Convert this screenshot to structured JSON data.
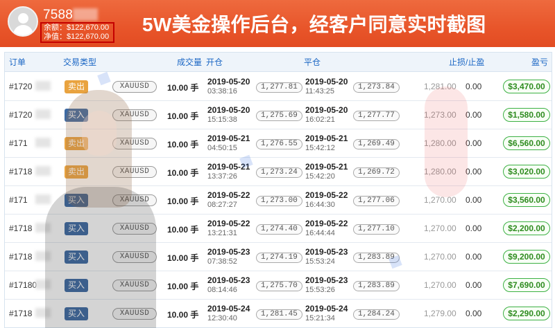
{
  "header": {
    "account_id": "7588",
    "balance": "余额：$122,670.00",
    "equity": "净值：$122,670.00",
    "headline": "5W美金操作后台，经客户同意实时截图",
    "colors": {
      "banner": "#e8552a",
      "highlight_box": "#c40000"
    }
  },
  "table": {
    "columns": {
      "order": "订单",
      "type": "交易类型",
      "volume": "成交量",
      "open": "开仓",
      "close": "平仓",
      "sl_tp": "止损/止盈",
      "profit": "盈亏"
    },
    "rows": [
      {
        "order": "#1720",
        "side": "卖出",
        "side_kind": "sell",
        "symbol": "XAUUSD",
        "volume": "10.00 手",
        "open_date": "2019-05-20",
        "open_time": "03:38:16",
        "open_price": "1,277.81",
        "close_date": "2019-05-20",
        "close_time": "11:43:25",
        "close_price": "1,273.84",
        "sl": "1,281.00",
        "tp": "0.00",
        "profit": "$3,470.00"
      },
      {
        "order": "#1720",
        "side": "买入",
        "side_kind": "buy",
        "symbol": "XAUUSD",
        "volume": "10.00 手",
        "open_date": "2019-05-20",
        "open_time": "15:15:38",
        "open_price": "1,275.69",
        "close_date": "2019-05-20",
        "close_time": "16:02:21",
        "close_price": "1,277.77",
        "sl": "1,273.00",
        "tp": "0.00",
        "profit": "$1,580.00"
      },
      {
        "order": "#171",
        "side": "卖出",
        "side_kind": "sell",
        "symbol": "XAUUSD",
        "volume": "10.00 手",
        "open_date": "2019-05-21",
        "open_time": "04:50:15",
        "open_price": "1,276.55",
        "close_date": "2019-05-21",
        "close_time": "15:42:12",
        "close_price": "1,269.49",
        "sl": "1,280.00",
        "tp": "0.00",
        "profit": "$6,560.00"
      },
      {
        "order": "#1718",
        "side": "卖出",
        "side_kind": "sell",
        "symbol": "XAUUSD",
        "volume": "10.00 手",
        "open_date": "2019-05-21",
        "open_time": "13:37:26",
        "open_price": "1,273.24",
        "close_date": "2019-05-21",
        "close_time": "15:42:20",
        "close_price": "1,269.72",
        "sl": "1,280.00",
        "tp": "0.00",
        "profit": "$3,020.00"
      },
      {
        "order": "#171",
        "side": "买入",
        "side_kind": "buy",
        "symbol": "XAUUSD",
        "volume": "10.00 手",
        "open_date": "2019-05-22",
        "open_time": "08:27:27",
        "open_price": "1,273.00",
        "close_date": "2019-05-22",
        "close_time": "16:44:30",
        "close_price": "1,277.06",
        "sl": "1,270.00",
        "tp": "0.00",
        "profit": "$3,560.00"
      },
      {
        "order": "#1718",
        "side": "买入",
        "side_kind": "buy",
        "symbol": "XAUUSD",
        "volume": "10.00 手",
        "open_date": "2019-05-22",
        "open_time": "13:21:31",
        "open_price": "1,274.40",
        "close_date": "2019-05-22",
        "close_time": "16:44:44",
        "close_price": "1,277.10",
        "sl": "1,270.00",
        "tp": "0.00",
        "profit": "$2,200.00"
      },
      {
        "order": "#1718",
        "side": "买入",
        "side_kind": "buy",
        "symbol": "XAUUSD",
        "volume": "10.00 手",
        "open_date": "2019-05-23",
        "open_time": "07:38:52",
        "open_price": "1,274.19",
        "close_date": "2019-05-23",
        "close_time": "15:53:24",
        "close_price": "1,283.89",
        "sl": "1,270.00",
        "tp": "0.00",
        "profit": "$9,200.00"
      },
      {
        "order": "#17180",
        "side": "买入",
        "side_kind": "buy",
        "symbol": "XAUUSD",
        "volume": "10.00 手",
        "open_date": "2019-05-23",
        "open_time": "08:14:46",
        "open_price": "1,275.70",
        "close_date": "2019-05-23",
        "close_time": "15:53:26",
        "close_price": "1,283.89",
        "sl": "1,270.00",
        "tp": "0.00",
        "profit": "$7,690.00"
      },
      {
        "order": "#1718",
        "side": "买入",
        "side_kind": "buy",
        "symbol": "XAUUSD",
        "volume": "10.00 手",
        "open_date": "2019-05-24",
        "open_time": "12:30:40",
        "open_price": "1,281.45",
        "close_date": "2019-05-24",
        "close_time": "15:21:34",
        "close_price": "1,284.24",
        "sl": "1,279.00",
        "tp": "0.00",
        "profit": "$2,290.00"
      }
    ],
    "colors": {
      "header_text": "#1a66c4",
      "buy_badge": "#3d6aa3",
      "sell_badge": "#e9a33f",
      "profit_text": "#2e8b1f"
    }
  }
}
